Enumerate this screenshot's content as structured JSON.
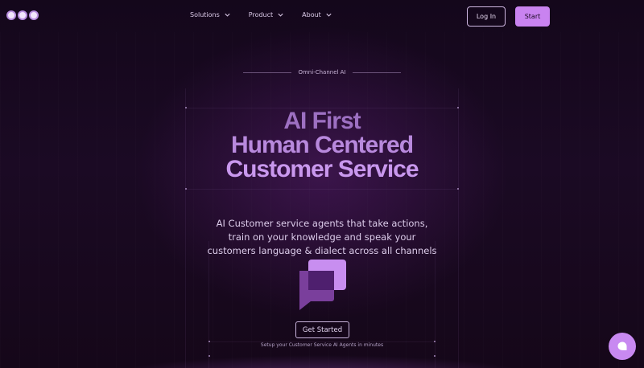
{
  "nav": {
    "items": [
      {
        "label": "Solutions",
        "icon": "chevron-down-icon"
      },
      {
        "label": "Product",
        "icon": "chevron-down-icon"
      },
      {
        "label": "About",
        "icon": "chevron-down-icon"
      }
    ],
    "login_label": "Log In",
    "start_label": "Start"
  },
  "hero": {
    "eyebrow": "Omni-Channel AI",
    "headline_lines": [
      "AI First",
      "Human Centered",
      "Customer Service"
    ],
    "description_lines": [
      "AI Customer service agents that take actions,",
      "train on your knowledge and speak your",
      "customers language & dialect across all channels"
    ],
    "cta_label": "Get Started",
    "cta_subtext": "Setup your Customer Service AI Agents in minutes"
  },
  "icons": {
    "logo": "logo-dots-icon",
    "hero": "chat-bubbles-icon",
    "fab": "chat-bubble-icon"
  },
  "colors": {
    "background": "#13061a",
    "accent": "#c983f0",
    "headline": "#b889dd"
  }
}
